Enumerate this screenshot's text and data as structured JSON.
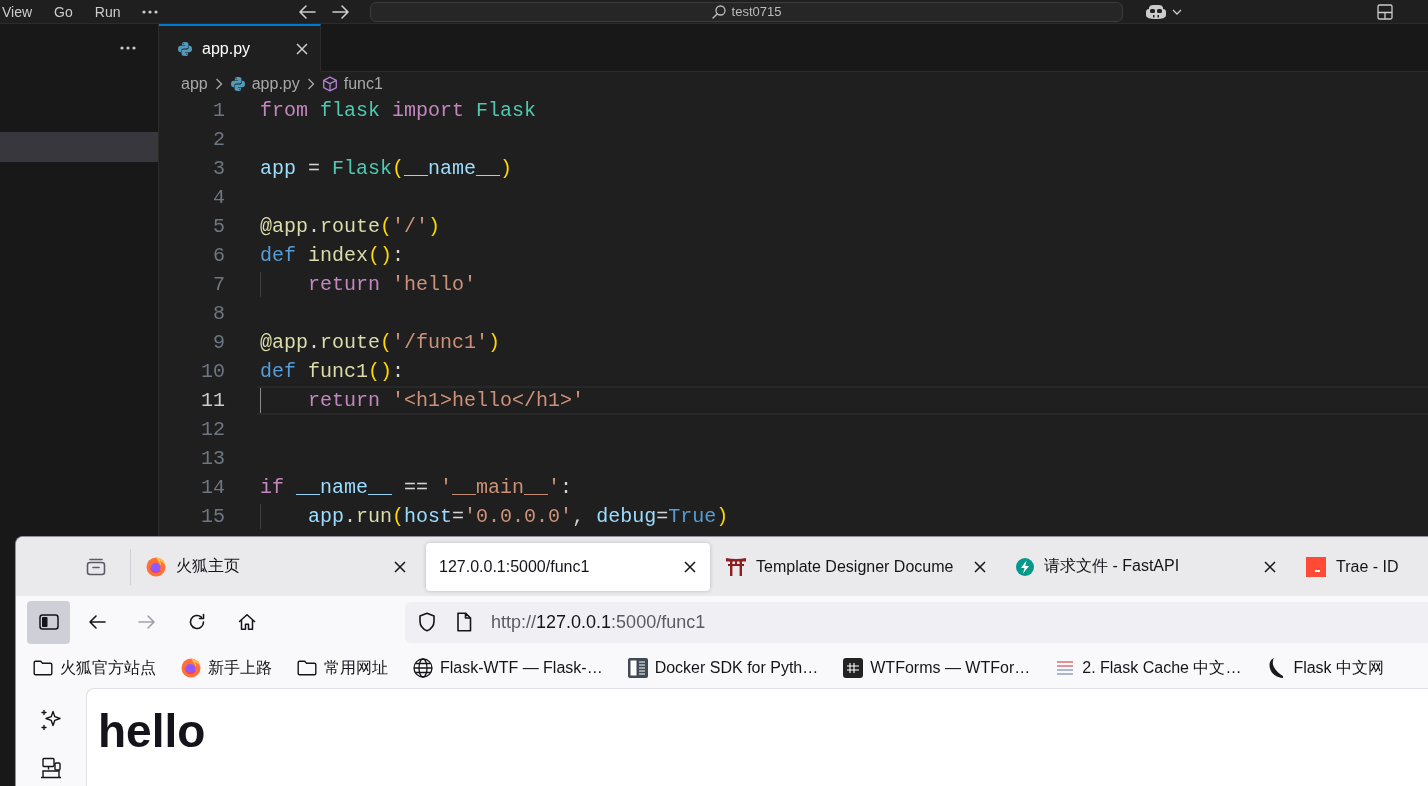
{
  "editor_window": {
    "menu": [
      "View",
      "Go",
      "Run"
    ],
    "search": {
      "value": "test0715"
    },
    "sidebar": {
      "rows": [
        {
          "selected": false
        },
        {
          "selected": false
        },
        {
          "selected": true
        }
      ]
    },
    "tabs": [
      {
        "label": "app.py",
        "selected": true
      }
    ],
    "breadcrumbs": [
      "app",
      "app.py",
      "func1"
    ],
    "code_lines": [
      {
        "number": "1",
        "current": false,
        "indented": false,
        "tokens": [
          {
            "text": "from ",
            "kind": "keyword"
          },
          {
            "text": "flask ",
            "kind": "class"
          },
          {
            "text": "import ",
            "kind": "keyword"
          },
          {
            "text": "Flask",
            "kind": "class"
          }
        ]
      },
      {
        "number": "2",
        "current": false,
        "indented": false
      },
      {
        "number": "3",
        "current": false,
        "indented": false,
        "tokens": [
          {
            "text": "app",
            "kind": "variable"
          },
          {
            "text": " = ",
            "kind": "plain"
          },
          {
            "text": "Flask",
            "kind": "class"
          },
          {
            "text": "(",
            "kind": "bracket"
          },
          {
            "text": "__name__",
            "kind": "variable"
          },
          {
            "text": ")",
            "kind": "bracket"
          }
        ]
      },
      {
        "number": "4",
        "current": false,
        "indented": false
      },
      {
        "number": "5",
        "current": false,
        "indented": false,
        "tokens": [
          {
            "text": "@app",
            "kind": "function"
          },
          {
            "text": ".",
            "kind": "plain"
          },
          {
            "text": "route",
            "kind": "function"
          },
          {
            "text": "(",
            "kind": "bracket"
          },
          {
            "text": "'/'",
            "kind": "string"
          },
          {
            "text": ")",
            "kind": "bracket"
          }
        ]
      },
      {
        "number": "6",
        "current": false,
        "indented": false,
        "tokens": [
          {
            "text": "def ",
            "kind": "storage"
          },
          {
            "text": "index",
            "kind": "function"
          },
          {
            "text": "()",
            "kind": "bracket"
          },
          {
            "text": ":",
            "kind": "plain"
          }
        ]
      },
      {
        "number": "7",
        "current": false,
        "indented": true,
        "tokens": [
          {
            "text": "return ",
            "kind": "keyword"
          },
          {
            "text": "'hello'",
            "kind": "string"
          }
        ]
      },
      {
        "number": "8",
        "current": false,
        "indented": false
      },
      {
        "number": "9",
        "current": false,
        "indented": false,
        "tokens": [
          {
            "text": "@app",
            "kind": "function"
          },
          {
            "text": ".",
            "kind": "plain"
          },
          {
            "text": "route",
            "kind": "function"
          },
          {
            "text": "(",
            "kind": "bracket"
          },
          {
            "text": "'/func1'",
            "kind": "string"
          },
          {
            "text": ")",
            "kind": "bracket"
          }
        ]
      },
      {
        "number": "10",
        "current": false,
        "indented": false,
        "tokens": [
          {
            "text": "def ",
            "kind": "storage"
          },
          {
            "text": "func1",
            "kind": "function"
          },
          {
            "text": "()",
            "kind": "bracket"
          },
          {
            "text": ":",
            "kind": "plain"
          }
        ]
      },
      {
        "number": "11",
        "current": true,
        "indented": true,
        "tokens": [
          {
            "text": "return ",
            "kind": "keyword"
          },
          {
            "text": "'<h1>hello</h1>'",
            "kind": "string"
          }
        ]
      },
      {
        "number": "12",
        "current": false,
        "indented": false
      },
      {
        "number": "13",
        "current": false,
        "indented": false
      },
      {
        "number": "14",
        "current": false,
        "indented": false,
        "tokens": [
          {
            "text": "if ",
            "kind": "keyword"
          },
          {
            "text": "__name__",
            "kind": "variable"
          },
          {
            "text": " == ",
            "kind": "plain"
          },
          {
            "text": "'__main__'",
            "kind": "string"
          },
          {
            "text": ":",
            "kind": "plain"
          }
        ]
      },
      {
        "number": "15",
        "current": false,
        "indented": true,
        "tokens": [
          {
            "text": "app",
            "kind": "variable"
          },
          {
            "text": ".",
            "kind": "plain"
          },
          {
            "text": "run",
            "kind": "function"
          },
          {
            "text": "(",
            "kind": "bracket"
          },
          {
            "text": "host",
            "kind": "variable"
          },
          {
            "text": "=",
            "kind": "plain"
          },
          {
            "text": "'0.0.0.0'",
            "kind": "string"
          },
          {
            "text": ", ",
            "kind": "plain"
          },
          {
            "text": "debug",
            "kind": "variable"
          },
          {
            "text": "=",
            "kind": "plain"
          },
          {
            "text": "True",
            "kind": "storage"
          },
          {
            "text": ")",
            "kind": "bracket"
          }
        ]
      }
    ]
  },
  "browser_window": {
    "tabs": [
      {
        "label": "火狐主页",
        "selected": false
      },
      {
        "label": "127.0.0.1:5000/func1",
        "selected": true
      },
      {
        "label": "Template Designer Docume",
        "selected": false
      },
      {
        "label": "请求文件 - FastAPI",
        "selected": false
      },
      {
        "label": "Trae - ID",
        "selected": false
      }
    ],
    "sidebar": {
      "open": true
    },
    "back": {
      "disabled": false
    },
    "forward": {
      "disabled": true
    },
    "url": "http://**127.0.0.1**:5000/func1",
    "bookmarks": [
      "火狐官方站点",
      "新手上路",
      "常用网址",
      "Flask-WTF — Flask-…",
      "Docker SDK for Pyth…",
      "WTForms — WTFor…",
      "2. Flask Cache 中文…",
      "Flask 中文网"
    ],
    "page": {
      "heading": "hello"
    }
  }
}
